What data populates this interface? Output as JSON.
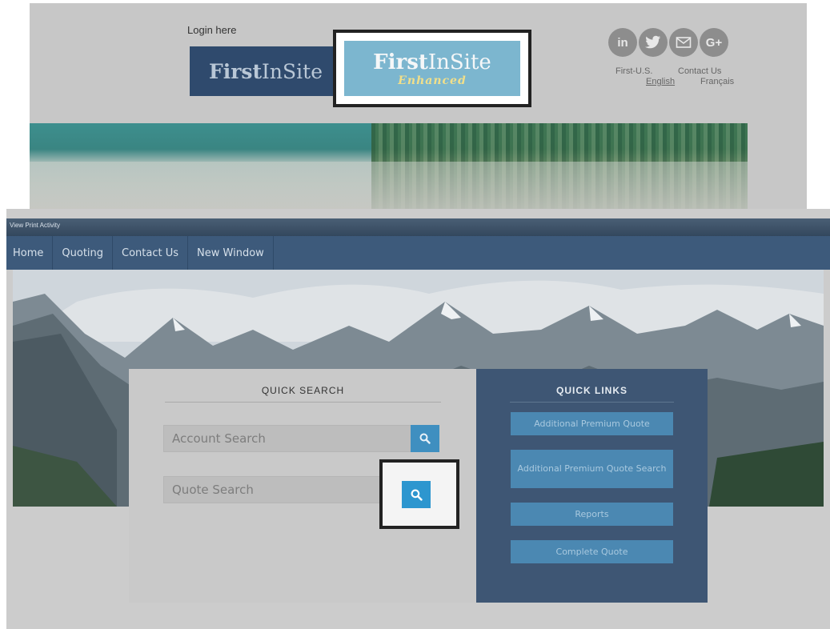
{
  "top": {
    "login_label": "Login here",
    "firstinsite_bold": "First",
    "firstinsite_light": "InSite",
    "enhanced_bold": "First",
    "enhanced_light": "InSite",
    "enhanced_tag": "Enhanced",
    "socials": [
      {
        "icon": "linkedin-icon",
        "glyph": "in"
      },
      {
        "icon": "twitter-icon",
        "glyph": "🐦"
      },
      {
        "icon": "email-icon",
        "glyph": "✉"
      },
      {
        "icon": "google-plus-icon",
        "glyph": "G+"
      }
    ],
    "links": {
      "first_us": "First-U.S.",
      "contact_us": "Contact Us",
      "english": "English",
      "francais": "Français"
    }
  },
  "main": {
    "top_strip": "View Print Activity",
    "nav": [
      "Home",
      "Quoting",
      "Contact Us",
      "New Window"
    ],
    "quick_search": {
      "title": "QUICK SEARCH",
      "account_placeholder": "Account Search",
      "quote_placeholder": "Quote Search"
    },
    "quick_links": {
      "title": "QUICK LINKS",
      "items": [
        "Additional Premium Quote",
        "Additional Premium Quote Search",
        "Reports",
        "Complete Quote"
      ]
    }
  },
  "colors": {
    "nav_bg": "#3d5a7b",
    "quick_links_bg": "#3e5674",
    "accent_button": "#3f8fc0"
  }
}
